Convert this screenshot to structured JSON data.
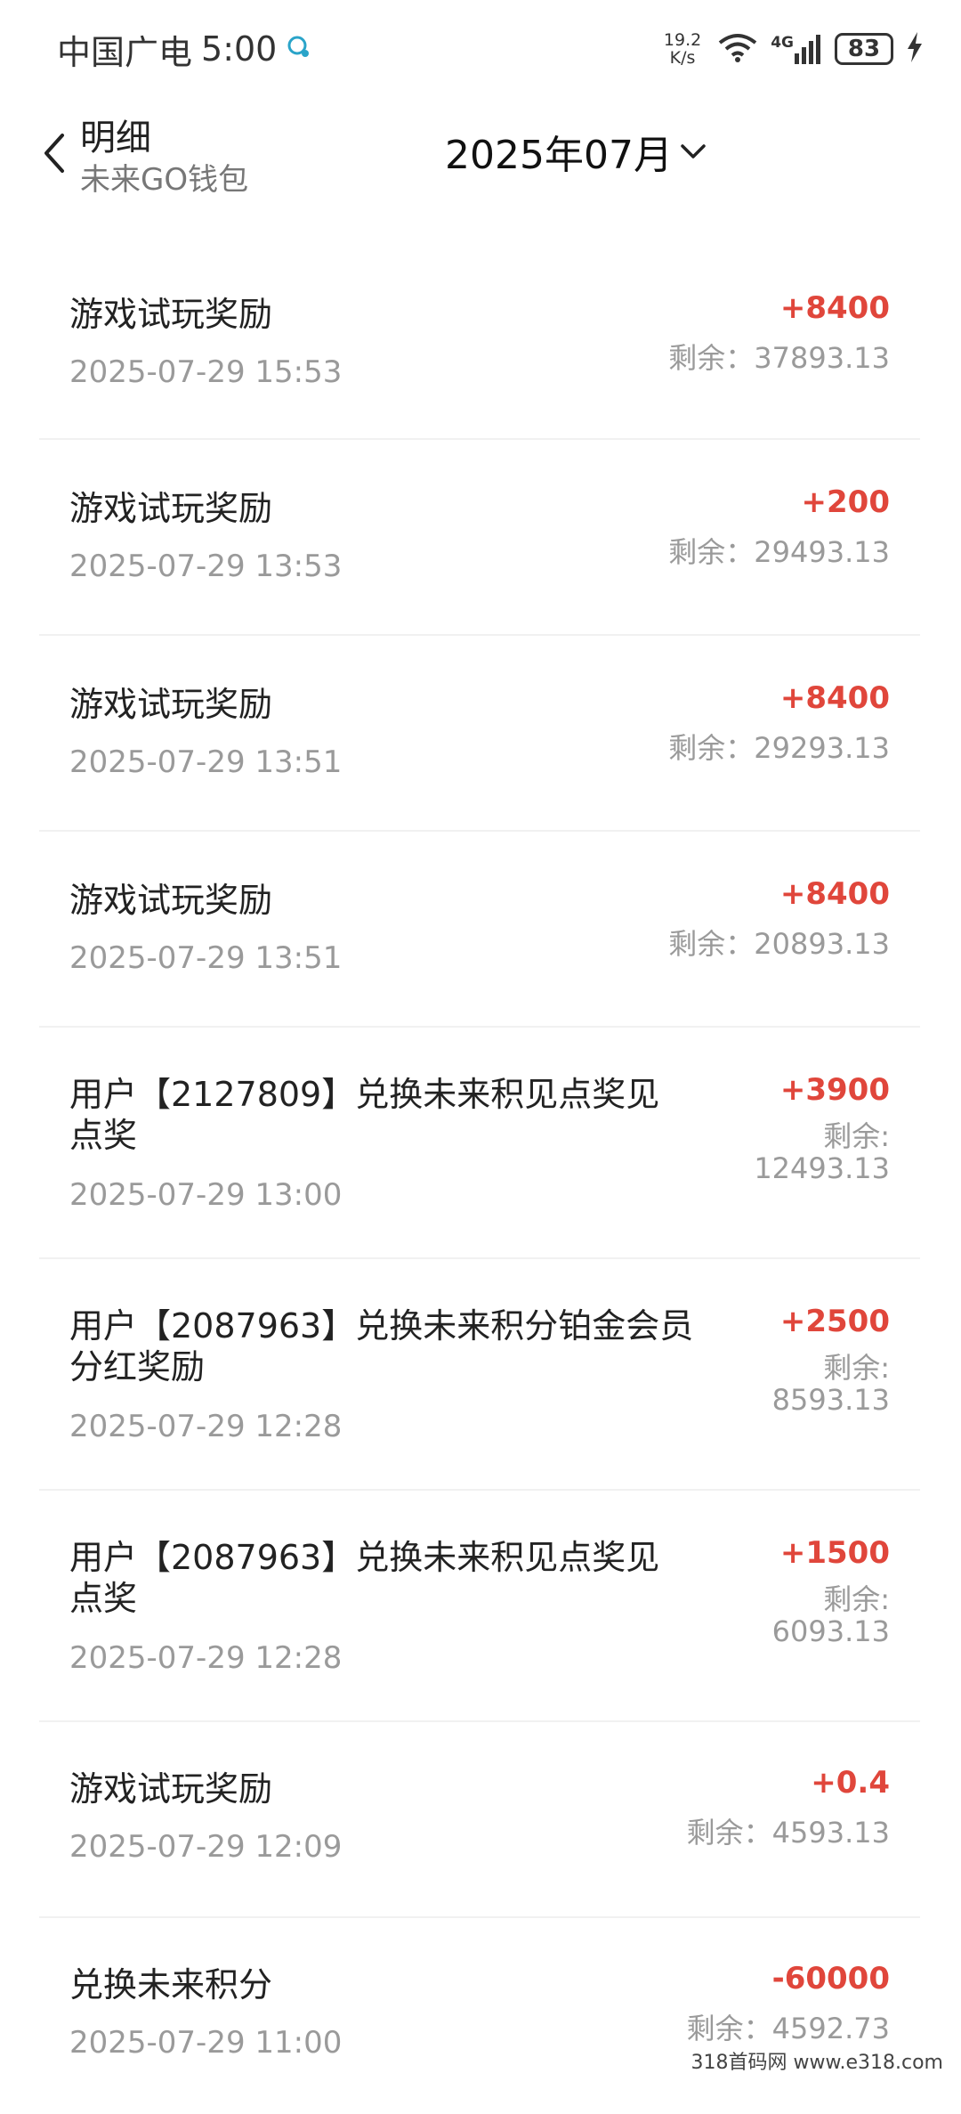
{
  "status_bar": {
    "carrier": "中国广电",
    "time": "5:00",
    "speed_value": "19.2",
    "speed_unit": "K/s",
    "network": "4G",
    "battery": "83"
  },
  "header": {
    "title": "明细",
    "subtitle": "未来GO钱包",
    "month": "2025年07月"
  },
  "balance_prefix": "剩余：",
  "records": [
    {
      "title": "游戏试玩奖励",
      "time": "2025-07-29 15:53",
      "amount": "+8400",
      "balance": "剩余：37893.13"
    },
    {
      "title": "游戏试玩奖励",
      "time": "2025-07-29 13:53",
      "amount": "+200",
      "balance": "剩余：29493.13"
    },
    {
      "title": "游戏试玩奖励",
      "time": "2025-07-29 13:51",
      "amount": "+8400",
      "balance": "剩余：29293.13"
    },
    {
      "title": "游戏试玩奖励",
      "time": "2025-07-29 13:51",
      "amount": "+8400",
      "balance": "剩余：20893.13"
    },
    {
      "title_line1": "用户【2127809】兑换未来积见点奖见",
      "title_line2": "点奖",
      "time": "2025-07-29 13:00",
      "amount": "+3900",
      "balance_label": "剩余:",
      "balance_value": "12493.13"
    },
    {
      "title_line1": "用户【2087963】兑换未来积分铂金会员",
      "title_line2": "分红奖励",
      "time": "2025-07-29 12:28",
      "amount": "+2500",
      "balance_label": "剩余:",
      "balance_value": "8593.13"
    },
    {
      "title_line1": "用户【2087963】兑换未来积见点奖见",
      "title_line2": "点奖",
      "time": "2025-07-29 12:28",
      "amount": "+1500",
      "balance_label": "剩余:",
      "balance_value": "6093.13"
    },
    {
      "title": "游戏试玩奖励",
      "time": "2025-07-29 12:09",
      "amount": "+0.4",
      "balance": "剩余：4593.13"
    },
    {
      "title": "兑换未来积分",
      "time": "2025-07-29 11:00",
      "amount": "-60000",
      "balance": "剩余：4592.73"
    }
  ],
  "watermark": "318首码网 www.e318.com",
  "colors": {
    "amount": "#e0463b",
    "muted": "#9a9a9a"
  }
}
